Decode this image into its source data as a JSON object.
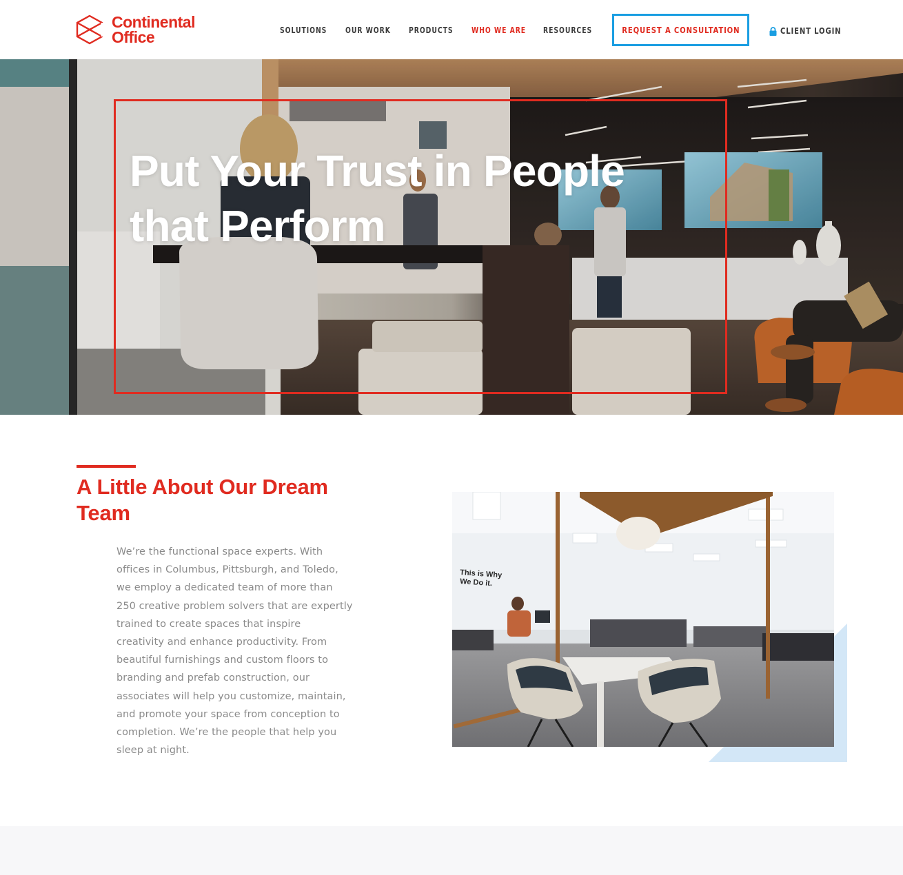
{
  "brand": {
    "name_line1": "Continental",
    "name_line2": "Office",
    "logo_icon": "cube-x-logo-icon",
    "primary_color": "#e02b20",
    "accent_color": "#1a9ee2"
  },
  "nav": {
    "items": [
      {
        "label": "SOLUTIONS",
        "active": false
      },
      {
        "label": "OUR WORK",
        "active": false
      },
      {
        "label": "PRODUCTS",
        "active": false
      },
      {
        "label": "WHO WE ARE",
        "active": true
      },
      {
        "label": "RESOURCES",
        "active": false
      }
    ],
    "cta_label": "REQUEST A CONSULTATION",
    "login_label": "CLIENT LOGIN",
    "login_icon": "lock-icon"
  },
  "hero": {
    "title_line1": "Put Your Trust in People",
    "title_line2": "that Perform",
    "image_alt": "Team collaborating in a modern office showroom"
  },
  "about": {
    "heading_line1": "A Little About Our Dream",
    "heading_line2": "Team",
    "body_lines": [
      "We’re the functional space experts. With",
      "offices in Columbus, Pittsburgh, and Toledo,",
      "we employ a dedicated team of more than",
      "250 creative problem solvers that are expertly",
      "trained to create spaces that inspire",
      "creativity and enhance productivity. From",
      "beautiful furnishings and custom floors to",
      "branding and prefab construction, our",
      "associates will help you customize, maintain,",
      "and promote your space from conception to",
      "completion. We’re the people that help you",
      "sleep at night."
    ],
    "photo_wall_text_line1": "This is Why",
    "photo_wall_text_line2": "We Do it.",
    "photo_alt": "Glass-walled meeting room in an open office"
  }
}
